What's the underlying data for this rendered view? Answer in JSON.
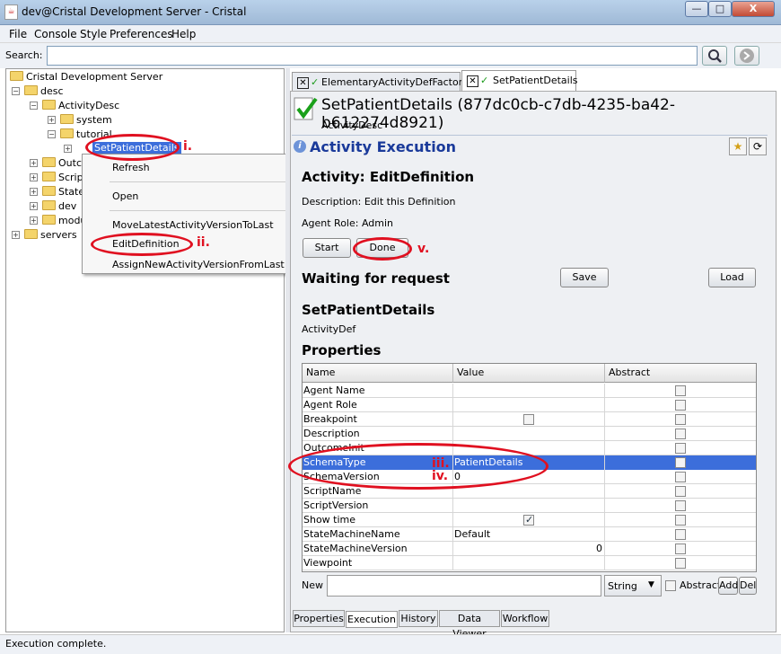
{
  "window": {
    "title": "dev@Cristal Development Server - Cristal",
    "minimize": "—",
    "maximize": "□",
    "close": "X"
  },
  "menubar": [
    "File",
    "Console",
    "Style",
    "Preferences",
    "Help"
  ],
  "search": {
    "label": "Search:",
    "value": ""
  },
  "tree": {
    "root": "Cristal Development Server",
    "desc": "desc",
    "activitydesc": "ActivityDesc",
    "system": "system",
    "tutorial": "tutorial",
    "setpatient": "SetPatientDetails",
    "outcome": "Outco",
    "script": "Script",
    "state": "State",
    "dev": "dev",
    "modules": "modu",
    "servers": "servers"
  },
  "context_menu": [
    "Refresh",
    "Open",
    "MoveLatestActivityVersionToLast",
    "EditDefinition",
    "AssignNewActivityVersionFromLast"
  ],
  "top_tabs": [
    {
      "label": "ElementaryActivityDefFactory"
    },
    {
      "label": "SetPatientDetails"
    }
  ],
  "item": {
    "title": "SetPatientDetails (877dc0cb-c7db-4235-ba42-b612274d8921)",
    "type": "ActivityDesc"
  },
  "execution": {
    "header": "Activity Execution",
    "activity": "Activity: EditDefinition",
    "description": "Description: Edit this Definition",
    "agent_role": "Agent Role: Admin",
    "start": "Start",
    "done": "Done",
    "waiting": "Waiting for request",
    "save": "Save",
    "load": "Load",
    "name": "SetPatientDetails",
    "def_type": "ActivityDef",
    "props_title": "Properties"
  },
  "grid": {
    "headers": [
      "Name",
      "Value",
      "Abstract"
    ],
    "rows": [
      {
        "name": "Agent Name",
        "value": ""
      },
      {
        "name": "Agent Role",
        "value": ""
      },
      {
        "name": "Breakpoint",
        "value": ""
      },
      {
        "name": "Description",
        "value": ""
      },
      {
        "name": "OutcomeInit",
        "value": ""
      },
      {
        "name": "SchemaType",
        "value": "PatientDetails"
      },
      {
        "name": "SchemaVersion",
        "value": "0"
      },
      {
        "name": "ScriptName",
        "value": ""
      },
      {
        "name": "ScriptVersion",
        "value": ""
      },
      {
        "name": "Show time",
        "value": ""
      },
      {
        "name": "StateMachineName",
        "value": "Default"
      },
      {
        "name": "StateMachineVersion",
        "value": "0"
      },
      {
        "name": "Viewpoint",
        "value": ""
      }
    ]
  },
  "newrow": {
    "label": "New :",
    "type": "String",
    "abstract": "Abstract",
    "add": "Add",
    "del": "Del"
  },
  "bottom_tabs": [
    "Properties",
    "Execution",
    "History",
    "Data Viewer",
    "Workflow"
  ],
  "status": "Execution complete.",
  "annotations": [
    "i.",
    "ii.",
    "iii.",
    "iv.",
    "v."
  ]
}
